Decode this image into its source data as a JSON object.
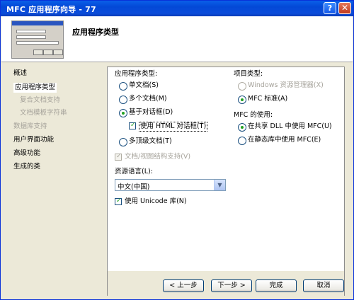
{
  "window": {
    "title": "MFC 应用程序向导 - 77",
    "help": "?",
    "close": "✕"
  },
  "header": {
    "title": "应用程序类型"
  },
  "nav": [
    {
      "label": "概述",
      "state": "normal"
    },
    {
      "label": "应用程序类型",
      "state": "selected"
    },
    {
      "label": "复合文档支持",
      "state": "disabled"
    },
    {
      "label": "文档模板字符串",
      "state": "disabled"
    },
    {
      "label": "数据库支持",
      "state": "disabled"
    },
    {
      "label": "用户界面功能",
      "state": "normal"
    },
    {
      "label": "高级功能",
      "state": "normal"
    },
    {
      "label": "生成的类",
      "state": "normal"
    }
  ],
  "app_type": {
    "label": "应用程序类型:",
    "options": [
      {
        "label": "单文档(S)",
        "selected": false
      },
      {
        "label": "多个文档(M)",
        "selected": false
      },
      {
        "label": "基于对话框(D)",
        "selected": true
      },
      {
        "label": "多顶级文档(T)",
        "selected": false
      }
    ],
    "html_dialog": {
      "label": "使用 HTML 对话框(T)",
      "checked": true
    },
    "doc_view": {
      "label": "文档/视图结构支持(V)",
      "checked": true,
      "enabled": false
    }
  },
  "project_type": {
    "label": "项目类型:",
    "options": [
      {
        "label": "Windows 资源管理器(X)",
        "selected": false,
        "enabled": false
      },
      {
        "label": "MFC 标准(A)",
        "selected": true,
        "enabled": true
      }
    ]
  },
  "mfc_use": {
    "label": "MFC 的使用:",
    "options": [
      {
        "label": "在共享 DLL 中使用 MFC(U)",
        "selected": true
      },
      {
        "label": "在静态库中使用 MFC(E)",
        "selected": false
      }
    ]
  },
  "resource_lang": {
    "label": "资源语言(L):",
    "value": "中文(中国)"
  },
  "unicode": {
    "label": "使用 Unicode 库(N)",
    "checked": true
  },
  "buttons": {
    "back": "< 上一步",
    "next": "下一步 >",
    "finish": "完成",
    "cancel": "取消"
  }
}
